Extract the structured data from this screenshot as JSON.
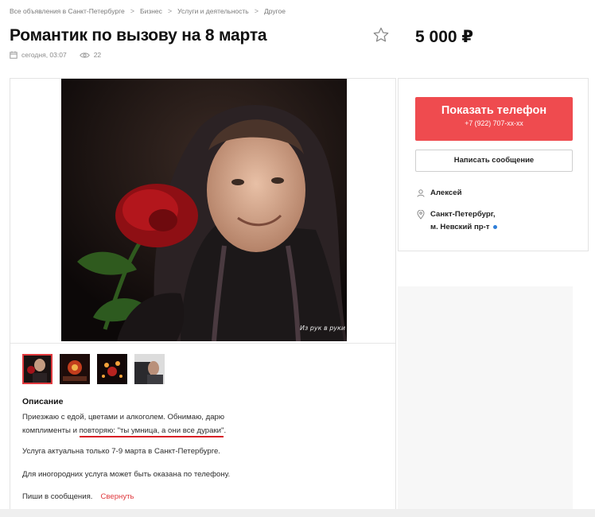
{
  "breadcrumb": {
    "items": [
      "Все объявления в Санкт-Петербурге",
      "Бизнес",
      "Услуги и деятельность",
      "Другое"
    ],
    "separator": ">"
  },
  "listing": {
    "title": "Романтик по вызову на 8 марта",
    "price": "5 000 ₽",
    "date": "сегодня, 03:07",
    "views": "22",
    "photo_watermark": "Из рук в руки"
  },
  "contact": {
    "show_phone_label": "Показать телефон",
    "phone_masked": "+7 (922) 707-хх-хх",
    "message_label": "Написать сообщение",
    "seller_name": "Алексей",
    "location_line1": "Санкт-Петербург,",
    "location_line2": "м. Невский пр-т"
  },
  "description": {
    "heading": "Описание",
    "p1_line1": "Приезжаю с едой, цветами и алкоголем. Обнимаю, дарю",
    "p1_line2_plain": "комплименты и ",
    "p1_line2_underlined": "повторяю: \"ты умница, а они все дураки\"",
    "p1_line2_end": ".",
    "p2": "Услуга актуальна только 7-9 марта в Санкт-Петербурге.",
    "p3": "Для иногородних услуга может быть оказана по телефону.",
    "p4": "Пиши в сообщения.",
    "collapse_label": "Свернуть"
  },
  "thumbnails": {
    "count": 4,
    "active_index": 0
  },
  "colors": {
    "accent_red": "#ef4b4f",
    "underline_red": "#d81f26",
    "metro_blue": "#2f7ed8"
  },
  "icons": [
    "chevron-right-icon",
    "star-icon",
    "calendar-icon",
    "eye-icon",
    "user-icon",
    "location-pin-icon"
  ]
}
